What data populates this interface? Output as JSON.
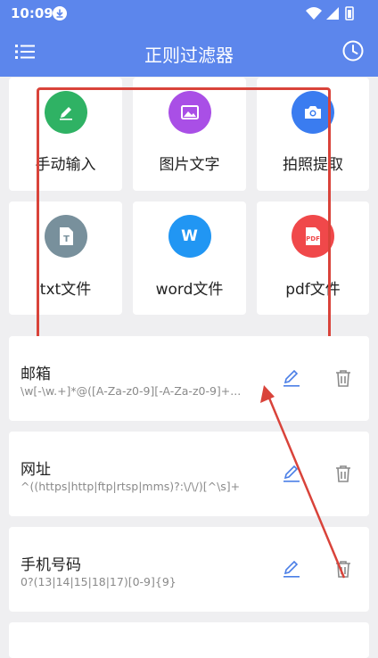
{
  "status": {
    "time": "10:09"
  },
  "appbar": {
    "title": "正则过滤器",
    "menu_icon": "list-menu-icon",
    "history_icon": "clock-icon"
  },
  "input_sources": [
    {
      "label": "手动输入",
      "icon": "pencil-icon",
      "color": "#2fb264"
    },
    {
      "label": "图片文字",
      "icon": "image-icon",
      "color": "#a94fe6"
    },
    {
      "label": "拍照提取",
      "icon": "camera-icon",
      "color": "#3a7cf0"
    },
    {
      "label": "txt文件",
      "icon": "txt-file-icon",
      "color": "#78909c",
      "glyph": "T"
    },
    {
      "label": "word文件",
      "icon": "word-icon",
      "color": "#2196f3",
      "glyph": "W"
    },
    {
      "label": "pdf文件",
      "icon": "pdf-file-icon",
      "color": "#f0484a",
      "glyph": "PDF"
    }
  ],
  "rules": [
    {
      "name": "邮箱",
      "pattern": "\\w[-\\w.+]*@([A-Za-z0-9][-A-Za-z0-9]+..."
    },
    {
      "name": "网址",
      "pattern": "^((https|http|ftp|rtsp|mms)?:\\/\\/)[^\\s]+"
    },
    {
      "name": "手机号码",
      "pattern": "0?(13|14|15|18|17)[0-9]{9}"
    }
  ],
  "colors": {
    "primary": "#5c86ec",
    "action": "#4a7ee6",
    "annotation": "#d9433a"
  }
}
